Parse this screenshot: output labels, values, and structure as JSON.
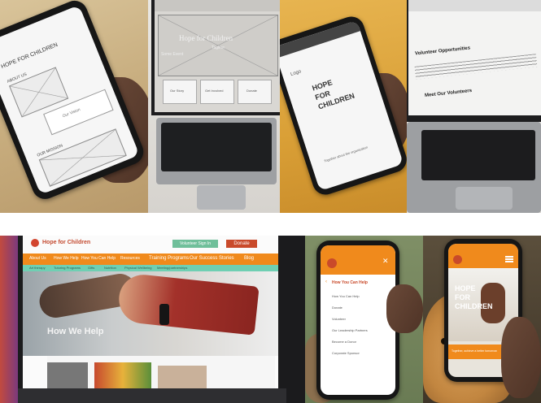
{
  "panel1": {
    "brand": "HOPE FOR CHILDREN",
    "section1": "ABOUT US",
    "section2": "OUR MISSION",
    "box_label": "Our Vision"
  },
  "panel2": {
    "hero_title": "Hope for Children",
    "hero_sub": "Tagline",
    "hero_left": "Some Event",
    "card1": "Our Story",
    "card2": "Get Involved",
    "card3": "Donate"
  },
  "panel3": {
    "logo": "Logo",
    "title_line1": "HOPE",
    "title_line2": "FOR",
    "title_line3": "CHILDREN",
    "tagline": "Together about the organization"
  },
  "panel4": {
    "heading1": "Volunteer Opportunities",
    "heading2": "Meet Our Volunteers"
  },
  "panel5": {
    "logo_text": "Hope for Children",
    "signin": "Volunteer Sign In",
    "donate": "Donate",
    "nav": [
      "About Us",
      "How We Help",
      "How You Can Help",
      "Resources",
      "Training Programs",
      "Our Success Stories",
      "Blog"
    ],
    "subnav": [
      "Art therapy",
      "Tutoring Programs",
      "Gifts",
      "Nutrition",
      "Physical Wellbeing",
      "Meeting/partnerships"
    ],
    "hero_heading": "How We Help"
  },
  "panel6": {
    "menu_heading": "How You Can Help",
    "menu_items": [
      "How You Can Help",
      "Donate",
      "Volunteer",
      "Our Leadership Partners",
      "Become a Donor",
      "Corporate Sponsor"
    ]
  },
  "panel7": {
    "hero_lines": [
      "HOPE",
      "FOR",
      "CHILDREN"
    ],
    "banner": "Together, achieve a better tomorrow"
  },
  "colors": {
    "orange": "#f08a1c",
    "teal": "#6fcfb3",
    "red_button": "#c94a2a",
    "signin_green": "#6fbf9a"
  }
}
